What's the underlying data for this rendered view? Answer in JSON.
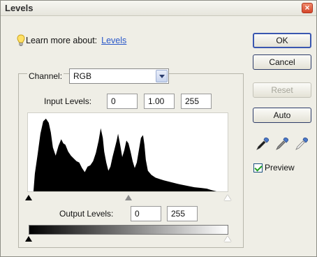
{
  "window": {
    "title": "Levels",
    "close_glyph": "×"
  },
  "learn": {
    "text": "Learn more about:",
    "link": "Levels"
  },
  "channel": {
    "label": "Channel:",
    "value": "RGB"
  },
  "input_levels": {
    "label": "Input Levels:",
    "black": "0",
    "gamma": "1.00",
    "white": "255",
    "black_level": 0,
    "gamma_value": 1.0,
    "white_level": 255
  },
  "output_levels": {
    "label": "Output Levels:",
    "black": "0",
    "white": "255",
    "black_level": 0,
    "white_level": 255
  },
  "buttons": {
    "ok": "OK",
    "cancel": "Cancel",
    "reset": "Reset",
    "auto": "Auto"
  },
  "preview": {
    "label": "Preview",
    "checked": true
  },
  "icons": {
    "info": "lightbulb-icon",
    "eyedroppers": [
      "black-eyedropper-icon",
      "gray-eyedropper-icon",
      "white-eyedropper-icon"
    ]
  },
  "colors": {
    "accent": "#2a58c9",
    "histogram": "#000000",
    "check": "#21a121"
  }
}
